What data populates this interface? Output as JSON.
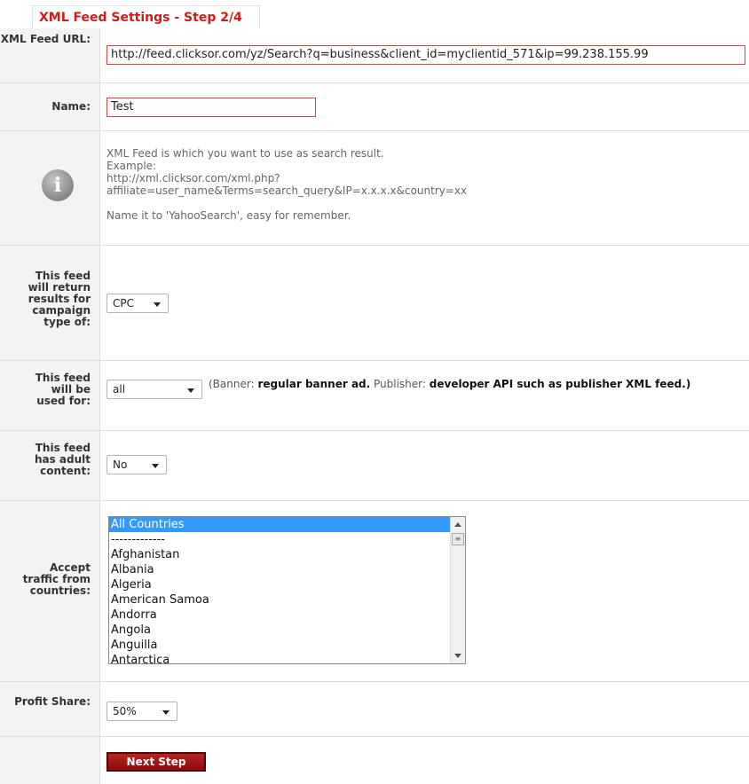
{
  "step_title": "XML Feed Settings - Step 2/4",
  "url_label": "XML Feed URL:",
  "url_value": "http://feed.clicksor.com/yz/Search?q=business&client_id=myclientid_571&ip=99.238.155.99",
  "name_label": "Name:",
  "name_value": "Test",
  "help": {
    "icon": "info-icon",
    "lines": [
      "XML Feed is which you want to use as search result.",
      "Example:",
      "http://xml.clicksor.com/xml.php?",
      "affiliate=user_name&Terms=search_query&IP=x.x.x.x&country=xx",
      "",
      "Name it to 'YahooSearch', easy for remember."
    ]
  },
  "campaign": {
    "label": "This feed will return results for campaign type of:",
    "value": "CPC"
  },
  "usage": {
    "label": "This feed will be used for:",
    "value": "all",
    "note_open": "(Banner: ",
    "note_banner": "regular banner ad.",
    "note_mid": " Publisher: ",
    "note_publisher": "developer API such as publisher XML feed.)"
  },
  "adult": {
    "label": "This feed has adult content:",
    "value": "No"
  },
  "countries": {
    "label": "Accept traffic from countries:",
    "options": [
      "All Countries",
      "-------------",
      "Afghanistan",
      "Albania",
      "Algeria",
      "American Samoa",
      "Andorra",
      "Angola",
      "Anguilla",
      "Antarctica"
    ],
    "selected": "All Countries"
  },
  "profit": {
    "label": "Profit Share:",
    "value": "50%"
  },
  "next_button": "Next Step"
}
